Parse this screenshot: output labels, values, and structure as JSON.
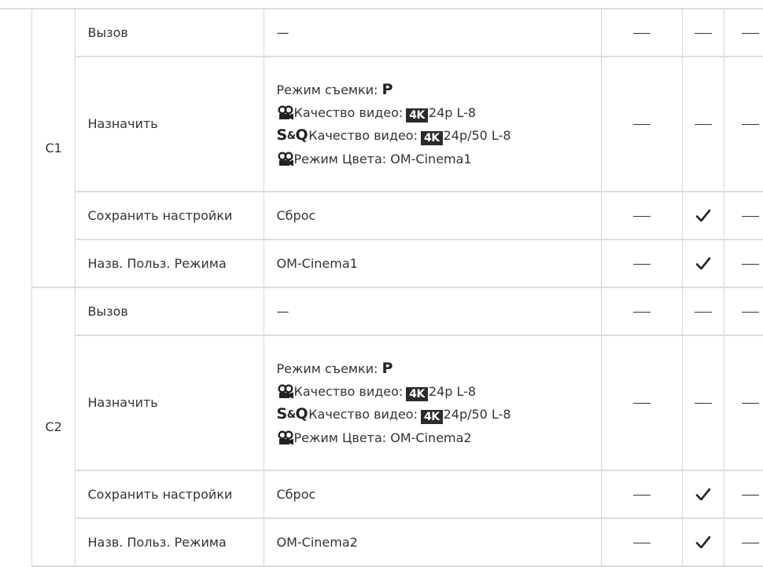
{
  "groups": [
    {
      "label": "C1",
      "rows": [
        {
          "action": "Вызов",
          "value": "—",
          "cols": [
            "dash",
            "dash",
            "dash"
          ]
        },
        {
          "action": "Назначить",
          "lines": {
            "shooting_mode_label": "Режим съемки:",
            "shooting_mode_value": "P",
            "video_quality_label": "Качество видео:",
            "video_quality_value": "24p L-8",
            "sq_prefix": "S",
            "sq_amp": "&",
            "sq_suffix": "Q",
            "sq_quality_label": "Качество видео:",
            "sq_quality_value": "24p/50 L-8",
            "color_mode": "Режим Цвета: OM-Cinema1",
            "badge": "4K"
          },
          "cols": [
            "dash",
            "dash",
            "dash"
          ]
        },
        {
          "action": "Сохранить настройки",
          "value": "Сброс",
          "cols": [
            "dash",
            "check",
            "dash"
          ]
        },
        {
          "action": "Назв. Польз. Режима",
          "value": "OM-Cinema1",
          "cols": [
            "dash",
            "check",
            "dash"
          ]
        }
      ]
    },
    {
      "label": "C2",
      "rows": [
        {
          "action": "Вызов",
          "value": "—",
          "cols": [
            "dash",
            "dash",
            "dash"
          ]
        },
        {
          "action": "Назначить",
          "lines": {
            "shooting_mode_label": "Режим съемки:",
            "shooting_mode_value": "P",
            "video_quality_label": "Качество видео:",
            "video_quality_value": "24p L-8",
            "sq_prefix": "S",
            "sq_amp": "&",
            "sq_suffix": "Q",
            "sq_quality_label": "Качество видео:",
            "sq_quality_value": "24p/50 L-8",
            "color_mode": "Режим Цвета: OM-Cinema2",
            "badge": "4K"
          },
          "cols": [
            "dash",
            "dash",
            "dash"
          ]
        },
        {
          "action": "Сохранить настройки",
          "value": "Сброс",
          "cols": [
            "dash",
            "check",
            "dash"
          ]
        },
        {
          "action": "Назв. Польз. Режима",
          "value": "OM-Cinema2",
          "cols": [
            "dash",
            "check",
            "dash"
          ]
        }
      ]
    }
  ],
  "icons": {
    "movie": "movie-camera-icon",
    "check": "checkmark-icon",
    "dash": "em-dash"
  }
}
